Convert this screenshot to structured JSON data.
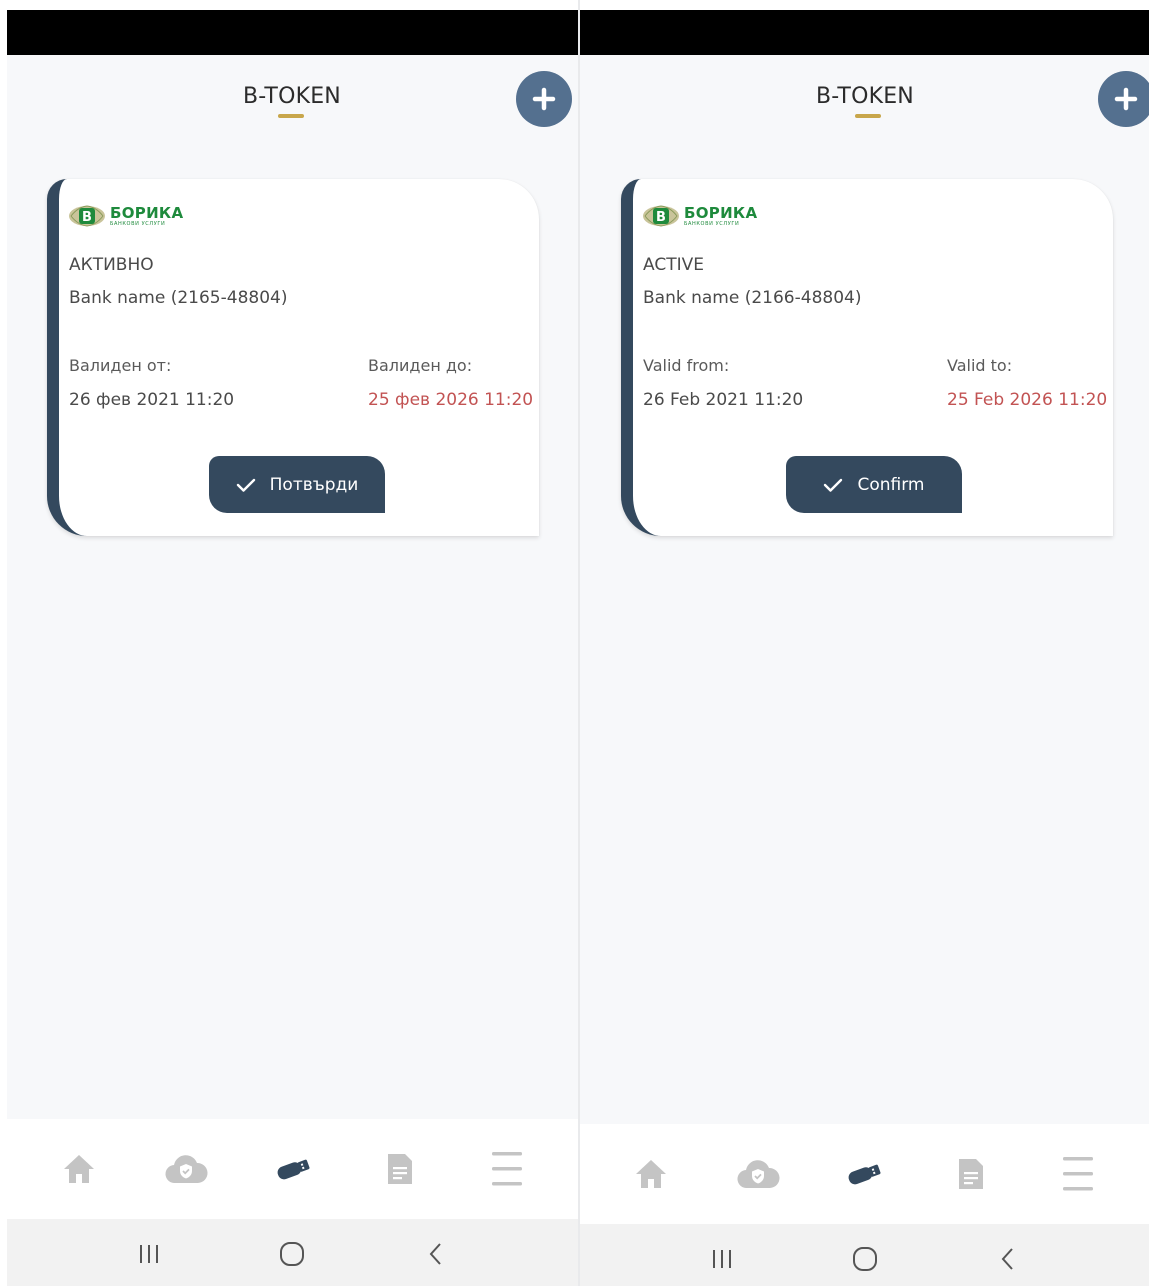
{
  "screens": [
    {
      "app_title": "B-TOKEN",
      "card": {
        "logo_name": "БОРИКА",
        "logo_sub": "БАНКОВИ УСЛУГИ",
        "status": "АКТИВНО",
        "bank_name": "Bank name (2165-48804)",
        "valid_from_label": "Валиден от:",
        "valid_from_value": "26 фев 2021 11:20",
        "valid_to_label": "Валиден до:",
        "valid_to_value": "25 фев 2026 11:20",
        "confirm_label": "Потвърди"
      }
    },
    {
      "app_title": "B-TOKEN",
      "card": {
        "logo_name": "БОРИКА",
        "logo_sub": "БАНКОВИ УСЛУГИ",
        "status": "ACTIVE",
        "bank_name": "Bank name (2166-48804)",
        "valid_from_label": "Valid from:",
        "valid_from_value": "26 Feb 2021 11:20",
        "valid_to_label": "Valid to:",
        "valid_to_value": "25 Feb 2026 11:20",
        "confirm_label": "Confirm"
      }
    }
  ],
  "nav_icons": [
    "home-icon",
    "cloud-shield-icon",
    "usb-token-icon",
    "document-icon",
    "menu-icon"
  ],
  "active_nav": "usb-token-icon",
  "system_nav_icons": [
    "recent-apps-icon",
    "home-circle-icon",
    "back-icon"
  ],
  "colors": {
    "accent": "#34495e",
    "add_button": "#54708f",
    "title_underline": "#c8a64b",
    "expiry_date": "#c25353",
    "logo_green": "#1e8a3c",
    "nav_inactive": "#c4c4c4"
  }
}
